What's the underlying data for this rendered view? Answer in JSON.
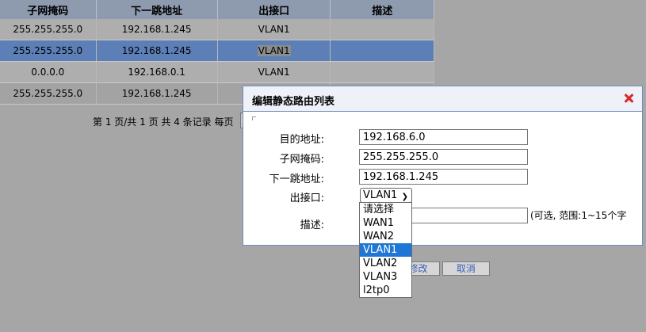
{
  "table": {
    "headers": [
      "子网掩码",
      "下一跳地址",
      "出接口",
      "描述"
    ],
    "rows": [
      {
        "mask": "255.255.255.0",
        "next_hop": "192.168.1.245",
        "iface": "VLAN1",
        "desc": ""
      },
      {
        "mask": "255.255.255.0",
        "next_hop": "192.168.1.245",
        "iface": "VLAN1",
        "desc": ""
      },
      {
        "mask": "0.0.0.0",
        "next_hop": "192.168.0.1",
        "iface": "VLAN1",
        "desc": ""
      },
      {
        "mask": "255.255.255.0",
        "next_hop": "192.168.1.245",
        "iface": "",
        "desc": ""
      }
    ]
  },
  "pager": {
    "text": "第 1 页/共 1 页 共 4 条记录 每页"
  },
  "dialog": {
    "title": "编辑静态路由列表",
    "labels": {
      "dest": "目的地址:",
      "mask": "子网掩码:",
      "next_hop": "下一跳地址:",
      "iface": "出接口:",
      "desc": "描述:"
    },
    "values": {
      "dest": "192.168.6.0",
      "mask": "255.255.255.0",
      "next_hop": "192.168.1.245",
      "iface": "VLAN1",
      "desc": ""
    },
    "hint": "(可选, 范围:1~15个字",
    "buttons": {
      "modify": "修改",
      "cancel": "取消"
    }
  },
  "dropdown": {
    "options": [
      "请选择",
      "WAN1",
      "WAN2",
      "VLAN1",
      "VLAN2",
      "VLAN3",
      "l2tp0"
    ],
    "selected": "VLAN1"
  },
  "colors": {
    "selected_row": "#5c7fb8",
    "dropdown_highlight": "#1e77d5",
    "close": "#d8272d"
  }
}
